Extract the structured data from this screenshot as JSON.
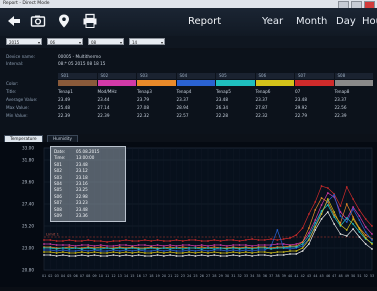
{
  "window": {
    "title": "Report - Direct Mode"
  },
  "toolbar": {
    "title": "Report",
    "tabs": [
      "Year",
      "Month",
      "Day",
      "Hou"
    ],
    "icons": [
      "back-arrow-icon",
      "camera-icon",
      "location-pin-icon",
      "print-icon"
    ]
  },
  "filters": [
    {
      "value": "2015"
    },
    {
      "value": "06"
    },
    {
      "value": "08"
    },
    {
      "value": "14"
    }
  ],
  "info": {
    "device_name_label": "Device name:",
    "device_name": "00005 - Multithermo",
    "interval_label": "Interval:",
    "interval": "08:* 05 2015 08 18 15",
    "labels": [
      "Color:",
      "Title:",
      "Average Value:",
      "Max Value:",
      "Min Value:"
    ]
  },
  "sensors": [
    {
      "id": "S01",
      "color": "#8a5a3a",
      "title": "Tenap1",
      "avg": "23.49",
      "max": "25.48",
      "min": "22.39"
    },
    {
      "id": "S02",
      "color": "#d23aa8",
      "title": "Mod/MHz",
      "avg": "23.44",
      "max": "27.14",
      "min": "22.39"
    },
    {
      "id": "S03",
      "color": "#e98a2a",
      "title": "Tenap3",
      "avg": "23.79",
      "max": "27.08",
      "min": "22.32"
    },
    {
      "id": "S04",
      "color": "#2a62d2",
      "title": "Tenap4",
      "avg": "23.37",
      "max": "28.94",
      "min": "22.57"
    },
    {
      "id": "S05",
      "color": "#1fbfbf",
      "title": "Tenap5",
      "avg": "23.48",
      "max": "26.34",
      "min": "22.28"
    },
    {
      "id": "S06",
      "color": "#d4c21a",
      "title": "Tenap6",
      "avg": "23.37",
      "max": "27.87",
      "min": "22.32"
    },
    {
      "id": "S07",
      "color": "#cf2b2b",
      "title": "07",
      "avg": "23.48",
      "max": "29.92",
      "min": "22.79"
    },
    {
      "id": "S08",
      "color": "#8a8a8a",
      "title": "Tenap8",
      "avg": "23.37",
      "max": "22.56",
      "min": "22.39"
    }
  ],
  "tabs": [
    "Temperature",
    "Humidity"
  ],
  "tooltip": {
    "rows": [
      {
        "k": "Date:",
        "v": "05.08.2015"
      },
      {
        "k": "Time:",
        "v": "13:00:00"
      },
      {
        "k": "S01",
        "v": "23.48"
      },
      {
        "k": "S02",
        "v": "23.12"
      },
      {
        "k": "S03",
        "v": "23.18"
      },
      {
        "k": "S04",
        "v": "23.16"
      },
      {
        "k": "S05",
        "v": "23.25"
      },
      {
        "k": "S06",
        "v": "22.98"
      },
      {
        "k": "S07",
        "v": "23.23"
      },
      {
        "k": "S08",
        "v": "23.48"
      },
      {
        "k": "S09",
        "v": "23.36"
      }
    ]
  },
  "limit_label": "Limit 1",
  "chart_data": {
    "type": "line",
    "y_ticks": [
      "33.00",
      "31.80",
      "29.60",
      "27.40",
      "25.20",
      "23.00",
      "20.80"
    ],
    "ylim": [
      20.8,
      33.0
    ],
    "limit": 24.1,
    "x_ticks": [
      "01",
      "02",
      "03",
      "04",
      "05",
      "06",
      "07",
      "08",
      "09",
      "10",
      "11",
      "12",
      "13",
      "14",
      "15",
      "16",
      "17",
      "18",
      "19",
      "20",
      "21",
      "22",
      "23",
      "24",
      "25",
      "26",
      "27",
      "28",
      "29",
      "30",
      "31",
      "32",
      "33",
      "34",
      "35",
      "36",
      "37",
      "38",
      "39",
      "40",
      "41",
      "42",
      "43",
      "44",
      "45",
      "46",
      "47",
      "48",
      "49",
      "50",
      "51",
      "52",
      "53"
    ],
    "series": [
      {
        "color": "#cf2b2b",
        "values": [
          23.8,
          23.8,
          23.7,
          23.7,
          23.8,
          23.7,
          23.7,
          23.8,
          23.7,
          23.7,
          23.6,
          23.7,
          23.7,
          23.8,
          23.7,
          23.7,
          23.8,
          23.7,
          23.8,
          23.7,
          23.7,
          23.8,
          23.7,
          23.8,
          23.8,
          23.7,
          23.7,
          23.8,
          23.7,
          23.8,
          23.8,
          23.7,
          23.8,
          23.9,
          23.8,
          23.8,
          23.9,
          23.8,
          23.9,
          24.0,
          24.3,
          25.0,
          26.4,
          27.6,
          29.2,
          29.0,
          28.4,
          27.2,
          29.1,
          27.9,
          26.8,
          25.9,
          25.2
        ]
      },
      {
        "color": "#d23aa8",
        "values": [
          23.4,
          23.4,
          23.3,
          23.3,
          23.3,
          23.2,
          23.3,
          23.3,
          23.2,
          23.3,
          23.2,
          23.2,
          23.3,
          23.3,
          23.2,
          23.3,
          23.3,
          23.2,
          23.3,
          23.2,
          23.3,
          23.2,
          23.3,
          23.3,
          23.2,
          23.3,
          23.2,
          23.3,
          23.3,
          23.2,
          23.3,
          23.3,
          23.3,
          23.2,
          23.3,
          23.3,
          23.3,
          23.4,
          23.4,
          23.3,
          23.4,
          23.6,
          24.5,
          25.8,
          27.3,
          28.5,
          28.1,
          26.6,
          25.9,
          27.1,
          26.2,
          25.1,
          24.4
        ]
      },
      {
        "color": "#e98a2a",
        "values": [
          23.1,
          23.1,
          23.0,
          23.0,
          23.1,
          23.0,
          23.0,
          23.1,
          23.0,
          23.1,
          23.0,
          23.0,
          23.1,
          23.0,
          23.1,
          23.0,
          23.0,
          23.1,
          23.0,
          23.0,
          23.1,
          23.0,
          23.1,
          23.0,
          23.0,
          23.1,
          23.0,
          23.1,
          23.0,
          23.0,
          23.1,
          23.0,
          23.1,
          23.0,
          23.1,
          23.1,
          23.0,
          23.1,
          23.1,
          23.2,
          23.2,
          23.6,
          25.0,
          26.8,
          28.0,
          27.6,
          26.3,
          25.5,
          27.4,
          26.1,
          25.0,
          24.3,
          23.9
        ]
      },
      {
        "color": "#2a62d2",
        "values": [
          22.8,
          22.8,
          22.7,
          22.8,
          22.7,
          22.7,
          22.8,
          22.7,
          22.8,
          22.7,
          22.7,
          22.8,
          22.7,
          22.8,
          22.7,
          22.8,
          22.7,
          22.7,
          22.8,
          22.7,
          22.8,
          22.7,
          22.7,
          22.8,
          22.7,
          22.8,
          22.7,
          22.8,
          22.8,
          22.7,
          22.8,
          22.7,
          22.8,
          22.7,
          22.8,
          22.8,
          23.2,
          24.8,
          23.0,
          22.9,
          23.0,
          23.2,
          23.9,
          25.2,
          26.6,
          27.7,
          28.3,
          26.2,
          25.6,
          26.9,
          25.8,
          24.6,
          23.8
        ]
      },
      {
        "color": "#1fbfbf",
        "values": [
          23.0,
          23.0,
          22.9,
          23.0,
          22.9,
          23.0,
          22.9,
          23.0,
          22.9,
          22.9,
          23.0,
          22.9,
          23.0,
          22.9,
          23.0,
          22.9,
          22.9,
          23.0,
          22.9,
          23.0,
          22.9,
          23.0,
          22.9,
          23.0,
          23.0,
          22.9,
          23.0,
          22.9,
          23.0,
          22.9,
          23.0,
          22.9,
          23.0,
          22.9,
          23.0,
          23.0,
          22.9,
          23.0,
          23.0,
          23.1,
          23.1,
          23.4,
          24.2,
          25.5,
          26.7,
          27.3,
          26.1,
          25.2,
          26.0,
          25.4,
          24.6,
          23.9,
          23.5
        ]
      },
      {
        "color": "#d4c21a",
        "values": [
          22.6,
          22.6,
          22.5,
          22.6,
          22.5,
          22.5,
          22.6,
          22.5,
          22.6,
          22.5,
          22.5,
          22.6,
          22.5,
          22.6,
          22.5,
          22.6,
          22.5,
          22.5,
          22.6,
          22.5,
          22.6,
          22.5,
          22.5,
          22.6,
          22.5,
          22.6,
          22.5,
          22.6,
          22.5,
          22.5,
          22.6,
          22.5,
          22.6,
          22.5,
          22.6,
          22.6,
          22.5,
          22.6,
          22.6,
          22.7,
          22.7,
          23.0,
          23.8,
          25.1,
          26.4,
          27.9,
          26.6,
          25.3,
          24.8,
          25.9,
          24.9,
          24.0,
          23.4
        ]
      },
      {
        "color": "#e8e8e8",
        "values": [
          22.3,
          22.3,
          22.2,
          22.3,
          22.2,
          22.2,
          22.3,
          22.2,
          22.3,
          22.2,
          22.2,
          22.3,
          22.2,
          22.3,
          22.2,
          22.3,
          22.2,
          22.2,
          22.3,
          22.2,
          22.3,
          22.2,
          22.2,
          22.3,
          22.2,
          22.3,
          22.2,
          22.3,
          22.2,
          22.2,
          22.3,
          22.2,
          22.3,
          22.2,
          22.3,
          22.3,
          22.2,
          22.3,
          22.3,
          22.4,
          22.4,
          22.7,
          23.4,
          24.8,
          25.9,
          26.6,
          25.4,
          24.4,
          24.2,
          24.9,
          24.1,
          23.4,
          22.9
        ]
      }
    ]
  }
}
